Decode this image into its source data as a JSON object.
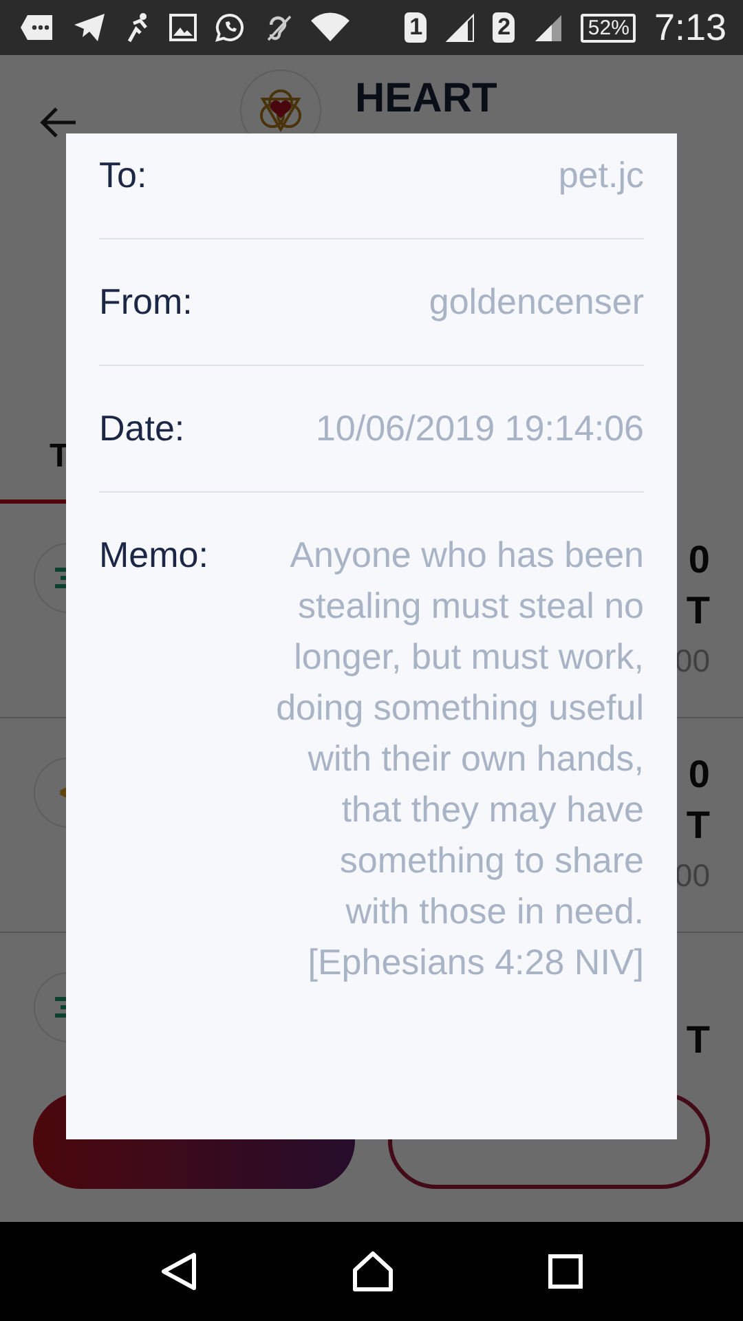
{
  "status_bar": {
    "sim_1": "1",
    "sim_2": "2",
    "battery": "52%",
    "time": "7:13"
  },
  "header": {
    "title": "HEART"
  },
  "tabs": [
    {
      "label": "T",
      "selected": true
    }
  ],
  "transactions": [
    {
      "kind": "receive",
      "amount": "0",
      "unit": "T",
      "fiat": "00"
    },
    {
      "kind": "send",
      "amount": "0",
      "unit": "T",
      "fiat": "00"
    },
    {
      "kind": "receive",
      "unit": "T"
    }
  ],
  "actions": [
    {
      "kind": "primary"
    },
    {
      "kind": "outline"
    }
  ],
  "dialog": {
    "fields": [
      {
        "label": "To:",
        "value": "pet.jc"
      },
      {
        "label": "From:",
        "value": "goldencenser"
      },
      {
        "label": "Date:",
        "value": "10/06/2019 19:14:06"
      },
      {
        "label": "Memo:",
        "value": "Anyone who has been stealing must steal no longer, but must work, doing something useful with their own hands, that they may have something to share with those in need. [Ephesians 4:28 NIV]"
      }
    ]
  }
}
